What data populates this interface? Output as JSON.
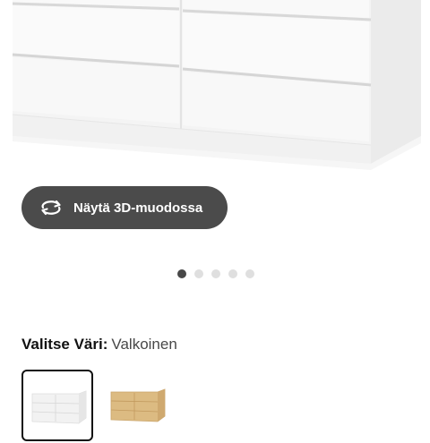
{
  "product_image": {
    "image_icon": "white-dresser-product-image"
  },
  "view3d": {
    "label": "Näytä 3D-muodossa",
    "icon": "rotate-3d-icon"
  },
  "carousel": {
    "slide_count": 5,
    "active_index": 0
  },
  "color": {
    "label": "Valitse Väri:",
    "selected": "Valkoinen",
    "options": [
      {
        "icon": "white-dresser-thumbnail",
        "swatch": "#f5f5f5",
        "selected": true
      },
      {
        "icon": "oak-dresser-thumbnail",
        "swatch": "#d9b77c",
        "selected": false
      }
    ]
  },
  "colors": {
    "button_bg": "#4b4b4b",
    "dot_active": "#484848",
    "dot_inactive": "#dfdfdf",
    "text": "#111111"
  }
}
